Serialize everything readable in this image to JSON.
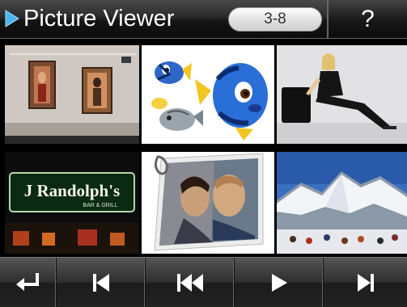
{
  "header": {
    "title": "Picture Viewer",
    "counter": "3-8",
    "help_label": "?"
  },
  "thumbnails": [
    {
      "name": "thumb-gallery-wall"
    },
    {
      "name": "thumb-cartoon-fish"
    },
    {
      "name": "thumb-woman-seated"
    },
    {
      "name": "thumb-restaurant-sign",
      "sign_text": "J Randolph's",
      "sign_subtext": "BAR & GRILL"
    },
    {
      "name": "thumb-couple-photo"
    },
    {
      "name": "thumb-snowy-mountains"
    }
  ],
  "toolbar": {
    "buttons": [
      "back",
      "previous",
      "first",
      "play",
      "next"
    ]
  },
  "colors": {
    "accent": "#3aa0e8",
    "header_bg": "#1a1a1a",
    "counter_bg": "#e8e8e8"
  }
}
